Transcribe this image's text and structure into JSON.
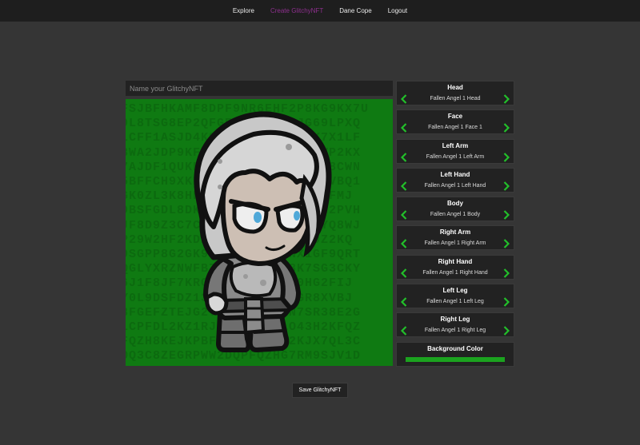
{
  "nav": {
    "items": [
      {
        "label": "Explore",
        "active": false
      },
      {
        "label": "Create GlitchyNFT",
        "active": true
      },
      {
        "label": "Dane Cope",
        "active": false
      },
      {
        "label": "Logout",
        "active": false
      }
    ]
  },
  "editor": {
    "name_placeholder": "Name your GlitchyNFT",
    "name_value": "",
    "background_color": "#0f7a12",
    "glitch_text": [
      "FSJBFHKAMF8DPF9NR6EHF2P8KG9KX7U",
      "9L8TSG8EP2QFGEHRX7FK18JG69LPXQ",
      "LCFF1ASJD4K8P2Q6F5CHNSG2K7X1LF",
      "3WA2JDP9KFZK8RTSK0GL9MGY7VP2KX",
      "7AJDF1QUKFQZHBCFNYFLL7P3RX8CWN",
      "5BFFCH9XKEHS9GF2DY8K7NWP6TVBQ1",
      "GK0ZL3K8HF0RSGPK72C1CNLY9BFMJ",
      "9BSFGDL8DKBOZZYEHPR3X6FJQW2PVH",
      "JF8D9Z3C7CK4RHYF1DGVKXRNRYQ8WJ",
      "P29W2HF2KDFEEKVLCFNHY8GNDZ2KQ",
      "9SGPP8G2GK9W8HFN3Y7XBNX1GF9QRT",
      "QGLYXRZNWFB7ECRMAIAJV8K7SG3CKY",
      "6J1F8JF7KRGWZK9BMTLBAQ0HG2FIJ",
      "Y0L9DSFDZ13G5LDKHAKN5YGR8XVBJ",
      "8FGEFZTEJG2T9ZBTPFY8KN7SR38E2G",
      "LCPFDL2KZ1RJXQHNP7YMLO43H2KFQZ",
      "FQZH8KEJKPBFWJDFWHBLZ2KJX7QL3C",
      "OQ3C8ZEGRPWW2DQPFQZHG7RM9SJV1D"
    ]
  },
  "parts": [
    {
      "title": "Head",
      "value": "Fallen Angel 1 Head"
    },
    {
      "title": "Face",
      "value": "Fallen Angel 1 Face 1"
    },
    {
      "title": "Left Arm",
      "value": "Fallen Angel 1 Left Arm"
    },
    {
      "title": "Left Hand",
      "value": "Fallen Angel 1 Left Hand"
    },
    {
      "title": "Body",
      "value": "Fallen Angel 1 Body"
    },
    {
      "title": "Right Arm",
      "value": "Fallen Angel 1 Right Arm"
    },
    {
      "title": "Right Hand",
      "value": "Fallen Angel 1 Right Hand"
    },
    {
      "title": "Left Leg",
      "value": "Fallen Angel 1 Left Leg"
    },
    {
      "title": "Right Leg",
      "value": "Fallen Angel 1 Right Leg"
    }
  ],
  "background_color": {
    "title": "Background Color",
    "value": "#1ba31f"
  },
  "save_button": {
    "label": "Save GlitchyNFT"
  },
  "icons": {
    "prev": "chevron-left-icon",
    "next": "chevron-right-icon",
    "arrow_color": "#22c02a"
  }
}
